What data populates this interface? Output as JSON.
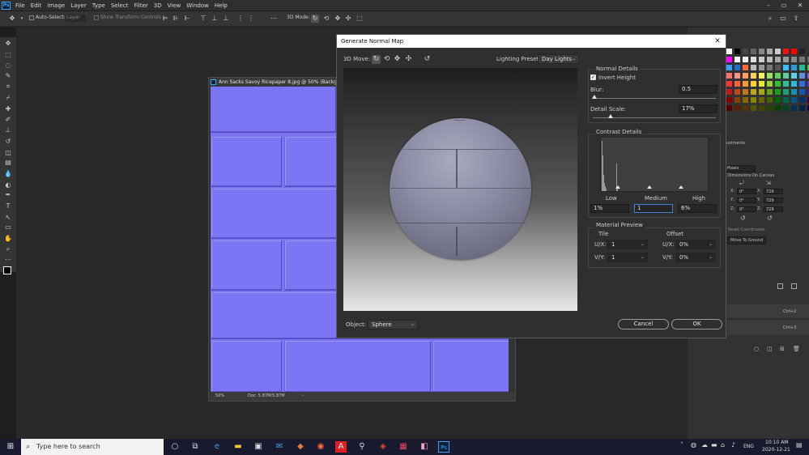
{
  "app": {
    "logo": "Ps",
    "menu": [
      "File",
      "Edit",
      "Image",
      "Layer",
      "Type",
      "Select",
      "Filter",
      "3D",
      "View",
      "Window",
      "Help"
    ]
  },
  "options_bar": {
    "auto_select": "Auto-Select:",
    "layer_select": "Layer",
    "show_transform": "Show Transform Controls",
    "mode_3d": "3D Mode:"
  },
  "document": {
    "title": "Ann Sacks Savoy Ricepaper 8.jpg @ 50% (Background",
    "zoom": "50%",
    "doc_size": "Doc: 5.87M/5.87M"
  },
  "dialog": {
    "title": "Generate Normal Map",
    "move_label": "3D Move:",
    "lighting_preset_label": "Lighting Preset:",
    "lighting_preset_value": "Day Lights",
    "object_label": "Object:",
    "object_value": "Sphere",
    "normal_details": {
      "heading": "Normal Details",
      "invert_height_label": "Invert Height",
      "invert_height_checked": true,
      "blur_label": "Blur:",
      "blur_value": "0.5",
      "detail_scale_label": "Detail Scale:",
      "detail_scale_value": "17%"
    },
    "contrast_details": {
      "heading": "Contrast Details",
      "low_label": "Low",
      "medium_label": "Medium",
      "high_label": "High",
      "low_value": "1%",
      "medium_value": "1",
      "high_value": "6%"
    },
    "material_preview": {
      "heading": "Material Preview",
      "tile_label": "Tile",
      "offset_label": "Offset",
      "ux_label": "U/X:",
      "vy_label": "V/Y:",
      "tile_ux": "1",
      "tile_vy": "1",
      "offset_ux": "0%",
      "offset_vy": "0%"
    },
    "cancel_label": "Cancel",
    "ok_label": "OK"
  },
  "right_panel": {
    "adjustments_label": "ustments",
    "pixels_label": "Pixels",
    "dimensions_label": "/ Dimensions On Canvas",
    "x_label": "X:",
    "y_label": "Y:",
    "z_label": "Z:",
    "rot_x": "0°",
    "rot_y": "0°",
    "rot_z": "0°",
    "scale_x": "729",
    "scale_y": "729",
    "scale_z": "729",
    "reset_coordinates": "Reset Coordinates",
    "move_to_ground": "Move To Ground",
    "shortcut_1": "Ctrl+2",
    "shortcut_2": "Ctrl+3"
  },
  "taskbar": {
    "search_placeholder": "Type here to search",
    "lang": "ENG",
    "time": "10:10 AM",
    "date": "2020-12-21"
  },
  "colors": {
    "normal_map_blue": "#7d76f4",
    "accent": "#31a8ff"
  }
}
